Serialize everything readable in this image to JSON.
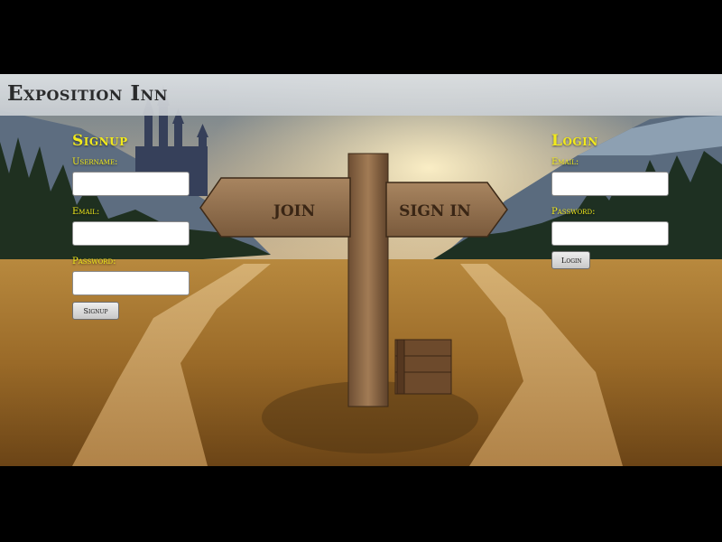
{
  "header": {
    "title": "Exposition Inn"
  },
  "scene": {
    "sign_left": "JOIN",
    "sign_right": "SIGN IN"
  },
  "signup": {
    "title": "Signup",
    "username_label": "Username:",
    "email_label": "Email:",
    "password_label": "Password:",
    "button_label": "Signup"
  },
  "login": {
    "title": "Login",
    "email_label": "Email:",
    "password_label": "Password:",
    "button_label": "Login"
  },
  "colors": {
    "accent": "#f2ea1c",
    "header_bg": "#d6dadd",
    "page_bg": "#000000"
  }
}
